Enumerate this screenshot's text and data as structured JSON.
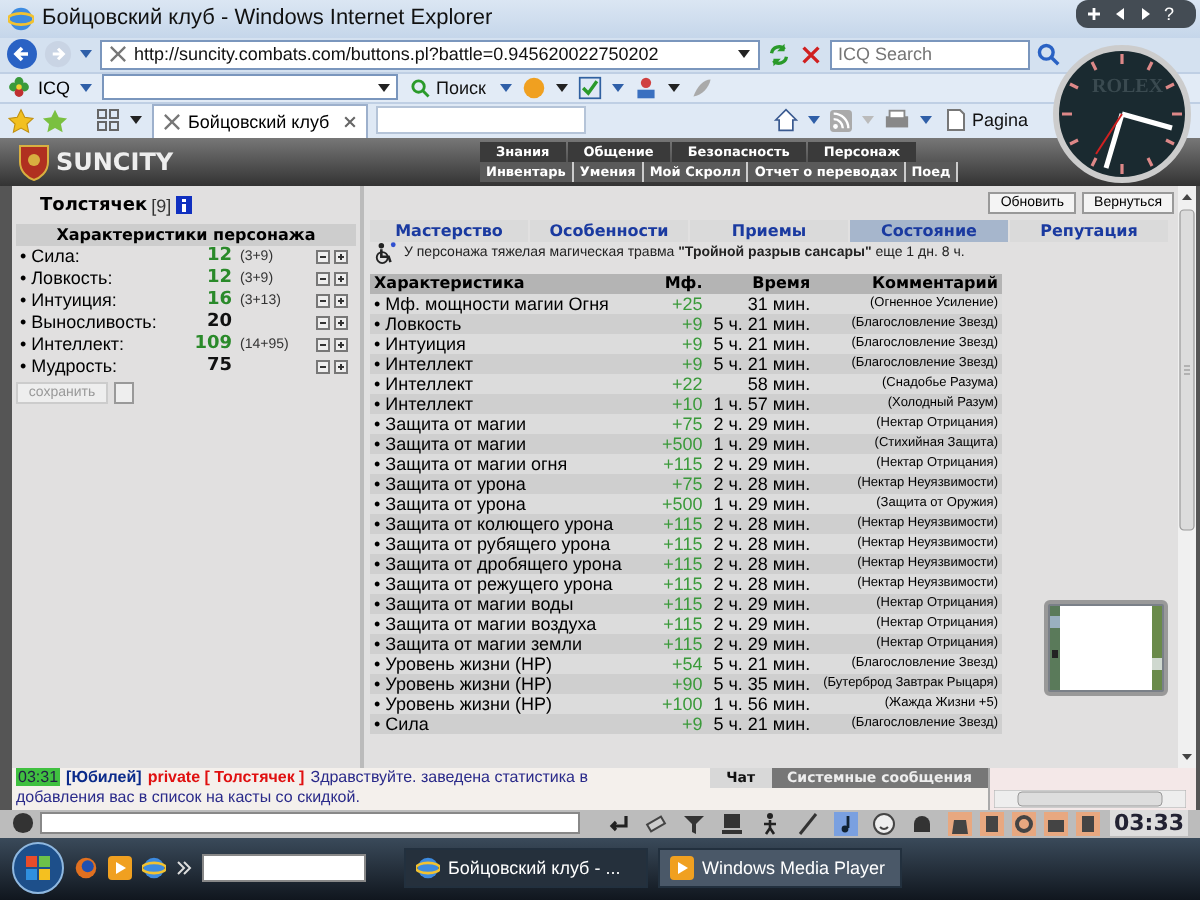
{
  "window": {
    "title": "Бойцовский клуб - Windows Internet Explorer"
  },
  "address_bar": {
    "url": "http://suncity.combats.com/buttons.pl?battle=0.945620022750202"
  },
  "search_box": {
    "placeholder": "ICQ Search"
  },
  "toolbar": {
    "brand": "ICQ",
    "search_button": "Поиск"
  },
  "browser_tabs": [
    {
      "label": "Бойцовский клуб",
      "selected": true
    }
  ],
  "command_bar": {
    "page_label": "Pagina"
  },
  "sidebar_gadget": {
    "help": "?",
    "clock_brand": "ROLEX"
  },
  "game_header": {
    "logo": "SUNCITY",
    "menu": [
      "Знания",
      "Общение",
      "Безопасность",
      "Персонаж"
    ],
    "submenu": [
      "Инвентарь",
      "Умения",
      "Мой Скролл",
      "Отчет о переводах",
      "Поед"
    ]
  },
  "character": {
    "name": "Толстячек",
    "rank": "[9]"
  },
  "stats": {
    "title": "Характеристики персонажа",
    "save_button": "сохранить",
    "save_checkbox": {
      "checked": false
    },
    "rows": [
      {
        "name": "• Сила:",
        "value": "12",
        "bonus": "(3+9)",
        "boosted": true
      },
      {
        "name": "• Ловкость:",
        "value": "12",
        "bonus": "(3+9)",
        "boosted": true
      },
      {
        "name": "• Интуиция:",
        "value": "16",
        "bonus": "(3+13)",
        "boosted": true
      },
      {
        "name": "• Выносливость:",
        "value": "20",
        "boosted": false
      },
      {
        "name": "• Интеллект:",
        "value": "109",
        "bonus": "(14+95)",
        "boosted": true
      },
      {
        "name": "• Мудрость:",
        "value": "75",
        "boosted": false
      }
    ]
  },
  "actions": [
    "Обновить",
    "Вернуться"
  ],
  "tabs": [
    {
      "label": "Мастерство",
      "selected": false
    },
    {
      "label": "Особенности",
      "selected": false
    },
    {
      "label": "Приемы",
      "selected": false
    },
    {
      "label": "Состояние",
      "selected": true
    },
    {
      "label": "Репутация",
      "selected": false
    }
  ],
  "notice": "У персонажа тяжелая магическая травма **\"Тройной разрыв сансары\"** еще 1 дн. 8 ч.",
  "effects": {
    "columns": [
      "Характеристика",
      "Мф.",
      "Время",
      "Комментарий"
    ],
    "rows": [
      {
        "stat": "• Мф. мощности магии Огня",
        "mf": "+25",
        "time": "31 мин.",
        "comment": "(Огненное Усиление)"
      },
      {
        "stat": "• Ловкость",
        "mf": "+9",
        "time": "5 ч. 21 мин.",
        "comment": "(Благословление Звезд)"
      },
      {
        "stat": "• Интуиция",
        "mf": "+9",
        "time": "5 ч. 21 мин.",
        "comment": "(Благословление Звезд)"
      },
      {
        "stat": "• Интеллект",
        "mf": "+9",
        "time": "5 ч. 21 мин.",
        "comment": "(Благословление Звезд)"
      },
      {
        "stat": "• Интеллект",
        "mf": "+22",
        "time": "58 мин.",
        "comment": "(Снадобье Разума)"
      },
      {
        "stat": "• Интеллект",
        "mf": "+10",
        "time": "1 ч. 57 мин.",
        "comment": "(Холодный Разум)"
      },
      {
        "stat": "• Защита от магии",
        "mf": "+75",
        "time": "2 ч. 29 мин.",
        "comment": "(Нектар Отрицания)"
      },
      {
        "stat": "• Защита от магии",
        "mf": "+500",
        "time": "1 ч. 29 мин.",
        "comment": "(Стихийная Защита)"
      },
      {
        "stat": "• Защита от магии огня",
        "mf": "+115",
        "time": "2 ч. 29 мин.",
        "comment": "(Нектар Отрицания)"
      },
      {
        "stat": "• Защита от урона",
        "mf": "+75",
        "time": "2 ч. 28 мин.",
        "comment": "(Нектар Неуязвимости)"
      },
      {
        "stat": "• Защита от урона",
        "mf": "+500",
        "time": "1 ч. 29 мин.",
        "comment": "(Защита от Оружия)"
      },
      {
        "stat": "• Защита от колющего урона",
        "mf": "+115",
        "time": "2 ч. 28 мин.",
        "comment": "(Нектар Неуязвимости)"
      },
      {
        "stat": "• Защита от рубящего урона",
        "mf": "+115",
        "time": "2 ч. 28 мин.",
        "comment": "(Нектар Неуязвимости)"
      },
      {
        "stat": "• Защита от дробящего урона",
        "mf": "+115",
        "time": "2 ч. 28 мин.",
        "comment": "(Нектар Неуязвимости)"
      },
      {
        "stat": "• Защита от режущего урона",
        "mf": "+115",
        "time": "2 ч. 28 мин.",
        "comment": "(Нектар Неуязвимости)"
      },
      {
        "stat": "• Защита от магии воды",
        "mf": "+115",
        "time": "2 ч. 29 мин.",
        "comment": "(Нектар Отрицания)"
      },
      {
        "stat": "• Защита от магии воздуха",
        "mf": "+115",
        "time": "2 ч. 29 мин.",
        "comment": "(Нектар Отрицания)"
      },
      {
        "stat": "• Защита от магии земли",
        "mf": "+115",
        "time": "2 ч. 29 мин.",
        "comment": "(Нектар Отрицания)"
      },
      {
        "stat": "• Уровень жизни (HP)",
        "mf": "+54",
        "time": "5 ч. 21 мин.",
        "comment": "(Благословление Звезд)"
      },
      {
        "stat": "• Уровень жизни (HP)",
        "mf": "+90",
        "time": "5 ч. 35 мин.",
        "comment": "(Бутерброд Завтрак Рыцаря)"
      },
      {
        "stat": "• Уровень жизни (HP)",
        "mf": "+100",
        "time": "1 ч. 56 мин.",
        "comment": "(Жажда Жизни +5)"
      },
      {
        "stat": "• Сила",
        "mf": "+9",
        "time": "5 ч. 21 мин.",
        "comment": "(Благословление Звезд)"
      }
    ]
  },
  "chat": {
    "tabs": [
      {
        "label": "Чат",
        "selected": true
      },
      {
        "label": "Системные сообщения",
        "selected": false
      }
    ],
    "message": {
      "time": "03:31",
      "channel": "[Юбилей]",
      "recipient": "private [ Толстячек ]",
      "text": "Здравствуйте. заведена статистика в",
      "continuation": "добавления вас в список на касты со скидкой."
    }
  },
  "game_clock": "03:33",
  "taskbar": {
    "buttons": [
      {
        "label": "Бойцовский клуб - ...",
        "selected": true
      },
      {
        "label": "Windows Media Player",
        "selected": false
      }
    ]
  }
}
